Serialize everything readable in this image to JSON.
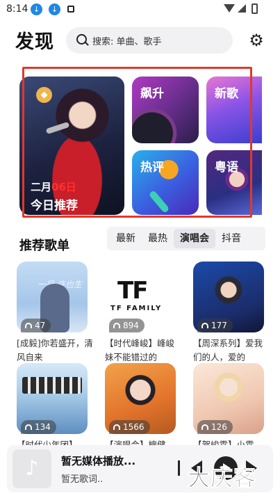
{
  "status_bar": {
    "time": "8:14",
    "icons": [
      "download-icon",
      "download-icon",
      "square-icon",
      "wifi-icon",
      "signal-icon",
      "battery-icon"
    ]
  },
  "header": {
    "title": "发现",
    "search_placeholder": "搜索: 单曲、歌手",
    "settings_icon": "gear-icon"
  },
  "featured": {
    "daily": {
      "date_prefix": "二月",
      "date_day": "06日",
      "label": "今日推荐",
      "badge_icon": "diamond-icon"
    },
    "cards": [
      {
        "label": "飙升"
      },
      {
        "label": "新歌"
      },
      {
        "label": "热评"
      },
      {
        "label": "粤语"
      }
    ]
  },
  "playlists": {
    "title": "推荐歌单",
    "tabs": [
      {
        "label": "最新",
        "active": false
      },
      {
        "label": "最热",
        "active": false
      },
      {
        "label": "演唱会",
        "active": true
      },
      {
        "label": "抖音",
        "active": false
      }
    ],
    "items": [
      {
        "plays": "47",
        "desc": "[成毅]你若盛开，清风自来",
        "cover_text": "一风 许也生"
      },
      {
        "plays": "894",
        "desc": "【时代峰峻】峰峻妹不能错过的",
        "cover_text": "TF FAMILY"
      },
      {
        "plays": "177",
        "desc": "【周深系列】爱我们的人，爱的"
      },
      {
        "plays": "134",
        "desc": "【时代少年团】"
      },
      {
        "plays": "1566",
        "desc": "【演唱会】檀健"
      },
      {
        "plays": "126",
        "desc": "【贺峻霖】小霖"
      }
    ]
  },
  "player": {
    "title": "暂无媒体播放...",
    "subtitle": "暂无歌词.."
  },
  "watermark": "大庆客"
}
